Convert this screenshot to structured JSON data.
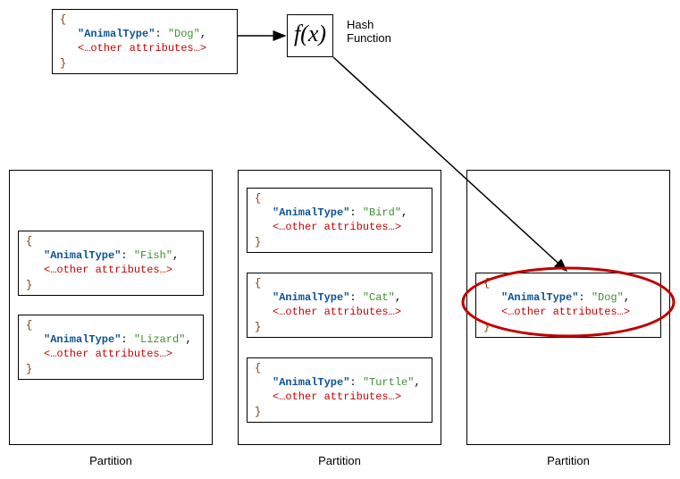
{
  "input_item": {
    "key": "\"AnimalType\"",
    "value": "\"Dog\"",
    "other": "<…other attributes…>"
  },
  "hash_fn": {
    "symbol": "f(x)",
    "label": "Hash Function"
  },
  "partitions": [
    {
      "label": "Partition",
      "items": [
        {
          "key": "\"AnimalType\"",
          "value": "\"Fish\"",
          "other": "<…other attributes…>"
        },
        {
          "key": "\"AnimalType\"",
          "value": "\"Lizard\"",
          "other": "<…other attributes…>"
        }
      ]
    },
    {
      "label": "Partition",
      "items": [
        {
          "key": "\"AnimalType\"",
          "value": "\"Bird\"",
          "other": "<…other attributes…>"
        },
        {
          "key": "\"AnimalType\"",
          "value": "\"Cat\"",
          "other": "<…other attributes…>"
        },
        {
          "key": "\"AnimalType\"",
          "value": "\"Turtle\"",
          "other": "<…other attributes…>"
        }
      ]
    },
    {
      "label": "Partition",
      "items": [
        {
          "key": "\"AnimalType\"",
          "value": "\"Dog\"",
          "other": "<…other attributes…>"
        }
      ]
    }
  ]
}
